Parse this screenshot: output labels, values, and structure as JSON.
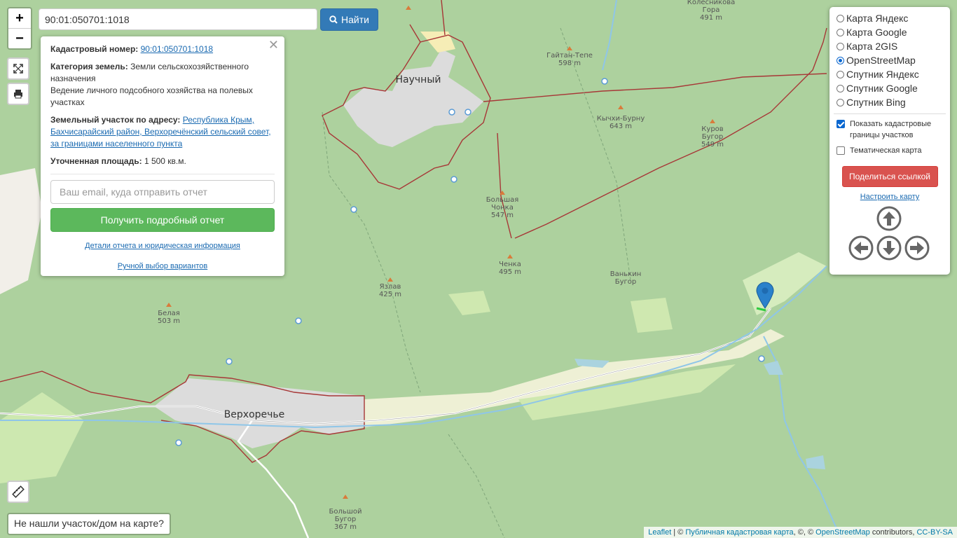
{
  "search": {
    "value": "90:01:050701:1018",
    "button_label": "Найти"
  },
  "zoom": {
    "in_label": "+",
    "out_label": "−"
  },
  "info": {
    "cadastral_label": "Кадастровый номер:",
    "cadastral_value": "90:01:050701:1018",
    "category_label": "Категория земель:",
    "category_value": "Земли сельскохозяйственного назначения",
    "usage": "Ведение личного подсобного хозяйства на полевых участках",
    "address_label": "Земельный участок по адресу:",
    "address_value": "Республика Крым, Бахчисарайский район, Верхоречёнский сельский совет, за границами населенного пункта",
    "area_label": "Уточненная площадь:",
    "area_value": "1 500 кв.м.",
    "email_placeholder": "Ваш email, куда отправить отчет",
    "report_button": "Получить подробный отчет",
    "details_link": "Детали отчета и юридическая информация",
    "manual_link": "Ручной выбор вариантов"
  },
  "layers": {
    "options": [
      {
        "label": "Карта Яндекс",
        "selected": false
      },
      {
        "label": "Карта Google",
        "selected": false
      },
      {
        "label": "Карта 2GIS",
        "selected": false
      },
      {
        "label": "OpenStreetMap",
        "selected": true
      },
      {
        "label": "Спутник Яндекс",
        "selected": false
      },
      {
        "label": "Спутник Google",
        "selected": false
      },
      {
        "label": "Спутник Bing",
        "selected": false
      }
    ],
    "show_borders": "Показать кадастровые границы участков",
    "thematic": "Тематическая карта",
    "share_button": "Поделиться ссылкой",
    "tune_link": "Настроить карту"
  },
  "map": {
    "towns": [
      "Научный",
      "Верхоречье"
    ],
    "peaks": [
      {
        "name": "Колесникова Гора",
        "elev": "491 m"
      },
      {
        "name": "Гайтан-Тепе",
        "elev": "598 m"
      },
      {
        "name": "Кычхи-Бурну",
        "elev": "643 m"
      },
      {
        "name": "Куров Бугор",
        "elev": "549 m"
      },
      {
        "name": "Большая Чонка",
        "elev": "547 m"
      },
      {
        "name": "Ченка",
        "elev": "495 m"
      },
      {
        "name": "Ванькин Бугор",
        "elev": ""
      },
      {
        "name": "Язлав",
        "elev": "425 m"
      },
      {
        "name": "Белая",
        "elev": "503 m"
      },
      {
        "name": "Большой Бугор",
        "elev": "367 m"
      }
    ]
  },
  "bottom": {
    "not_found": "Не нашли участок/дом на карте?"
  },
  "attribution": {
    "leaflet": "Leaflet",
    "sep1": " | © ",
    "pkk": "Публичная кадастровая карта",
    "sep2": ", ©, © ",
    "osm": "OpenStreetMap",
    "contrib": " contributors, ",
    "license": "CC-BY-SA"
  }
}
